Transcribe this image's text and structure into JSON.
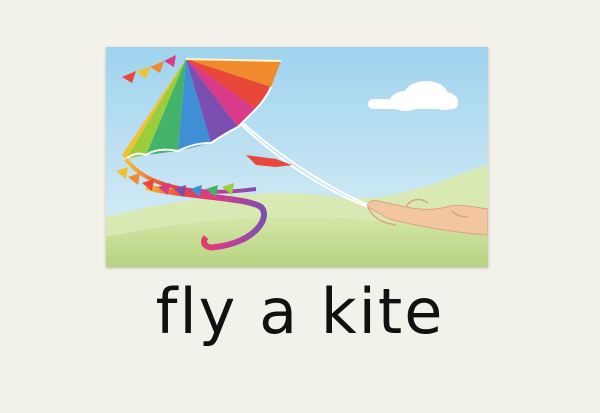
{
  "caption": {
    "text": "fly a kite"
  },
  "illustration": {
    "sky_color": "#bfe3f2",
    "hill_color": "#c9df9c",
    "kite_colors": [
      "#f2c230",
      "#ef8b2c",
      "#e8473a",
      "#d93a8a",
      "#7b4fb0",
      "#3f8fd6",
      "#44b36a",
      "#9acd3a"
    ],
    "string_color": "#ffffff",
    "skin_color": "#f2c6a0"
  }
}
